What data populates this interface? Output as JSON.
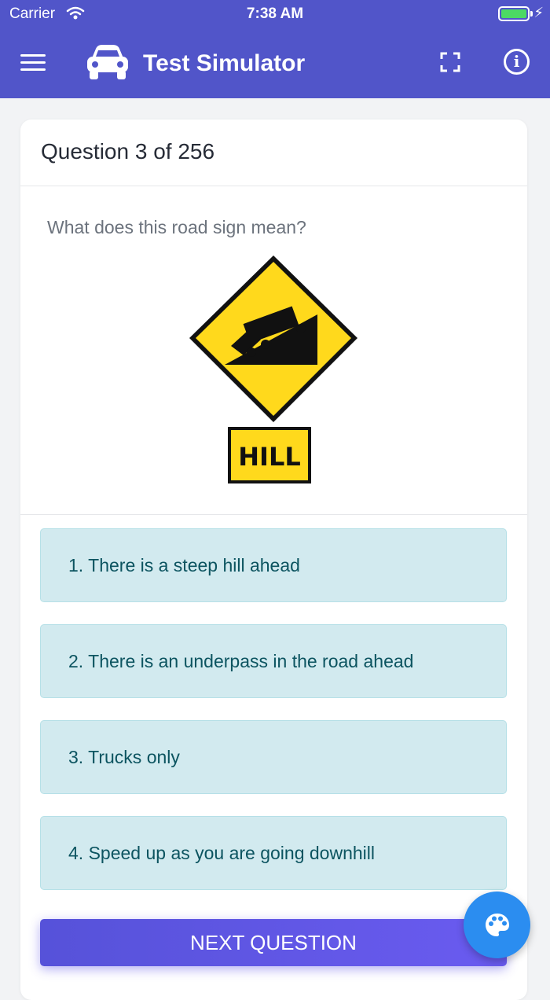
{
  "status_bar": {
    "carrier": "Carrier",
    "time": "7:38 AM"
  },
  "header": {
    "title": "Test Simulator",
    "icons": [
      "menu-icon",
      "car-icon",
      "fullscreen-icon",
      "info-icon"
    ]
  },
  "question": {
    "header": "Question 3 of 256",
    "prompt": "What does this road sign mean?",
    "sign_text": "HILL"
  },
  "answers": [
    "1. There is a steep hill ahead",
    "2. There is an underpass in the road ahead",
    "3. Trucks only",
    "4. Speed up as you are going downhill"
  ],
  "next_button": "NEXT QUESTION",
  "fab_icon": "palette-icon",
  "colors": {
    "brand": "#5155c9",
    "answer_bg": "#d2eaef",
    "answer_text": "#0c5460",
    "sign_yellow": "#ffd91c",
    "fab": "#2b8df0"
  }
}
